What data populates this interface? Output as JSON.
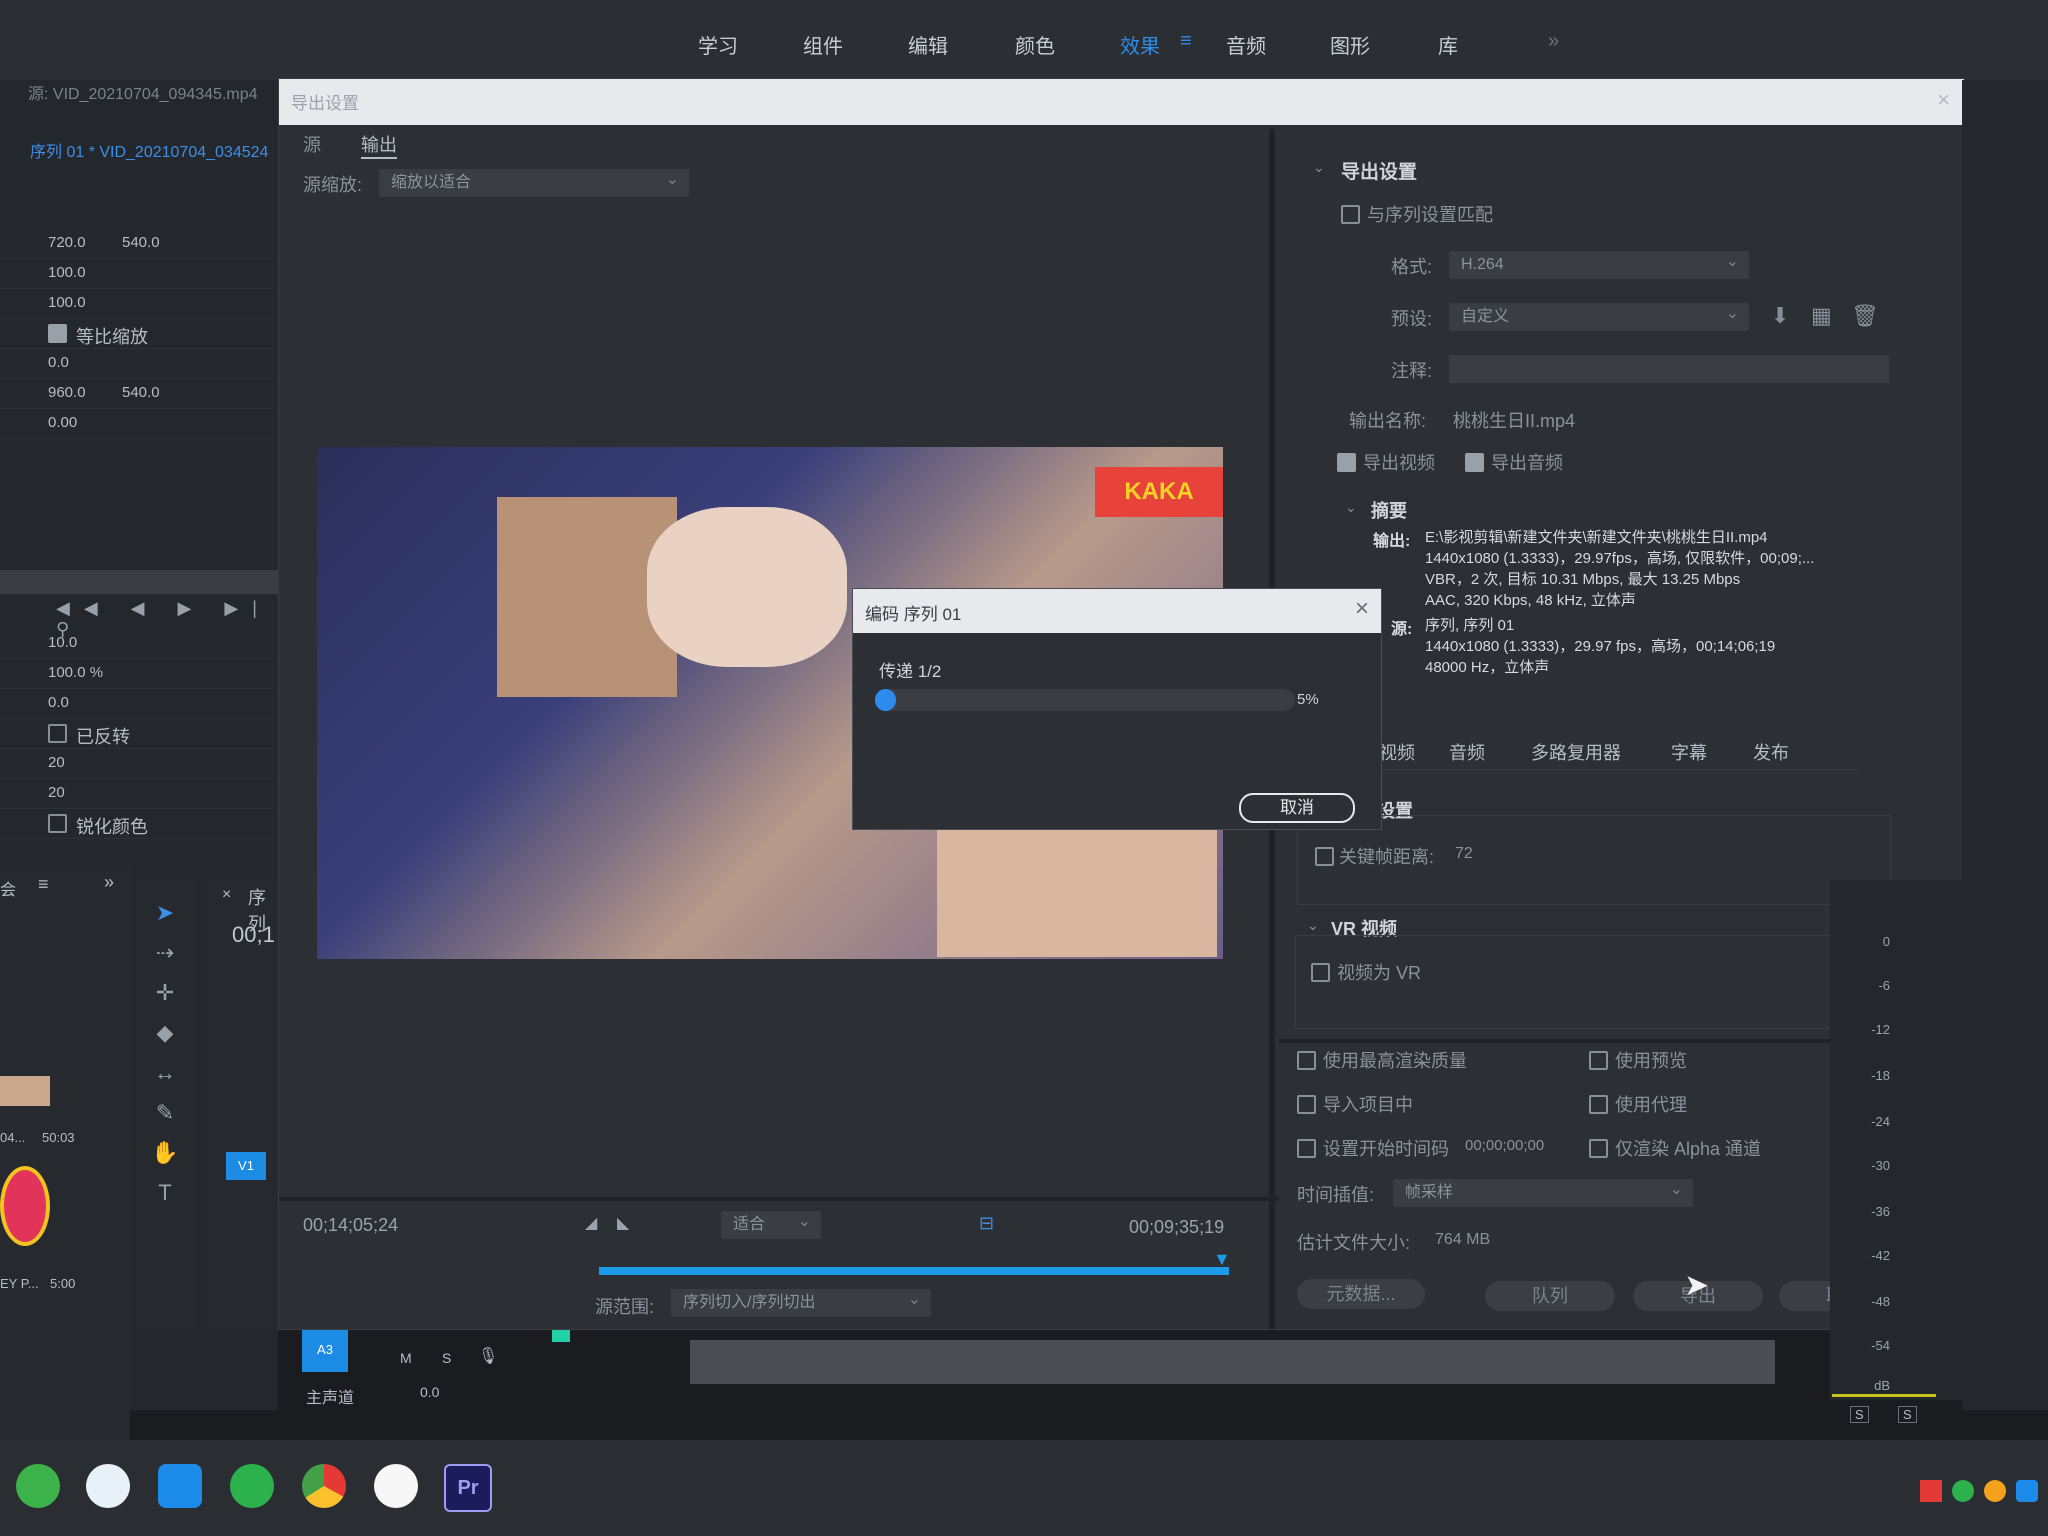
{
  "workspace_tabs": [
    "学习",
    "组件",
    "编辑",
    "颜色",
    "效果",
    "音频",
    "图形",
    "库"
  ],
  "active_workspace": "效果",
  "more_workspaces": "»",
  "source_tab": "源: VID_20210704_094345.mp4",
  "effect_controls": {
    "sequence_label": "序列 01 * VID_20210704_034524",
    "position": [
      "720.0",
      "540.0"
    ],
    "scale": "100.0",
    "scale_width": "100.0",
    "uniform_scale": "等比缩放",
    "rotation": "0.0",
    "anchor": [
      "960.0",
      "540.0"
    ],
    "anti_flicker": "0.00",
    "v2_values": [
      "10.0",
      "100.0 %",
      "0.0"
    ],
    "inverted": "已反转",
    "v3_values": [
      "20",
      "20"
    ],
    "sharpen": "锐化颜色"
  },
  "project_panel": {
    "tab_label": "会",
    "clip1_name": "04...",
    "clip1_dur": "50:03",
    "clip2_name": "EY P...",
    "clip2_dur": "5:00"
  },
  "timeline": {
    "tab_label": "序列",
    "timecode": "00;1",
    "track_v1": "V1",
    "track_a3": "A3",
    "m": "M",
    "s": "S",
    "master": "主声道",
    "master_val": "0.0"
  },
  "export_dialog": {
    "title": "导出设置",
    "tab_source": "源",
    "tab_output": "输出",
    "source_scaling_label": "源缩放:",
    "source_scaling_value": "缩放以适合",
    "watermark": "KAKA",
    "timecode_in": "00;14;05;24",
    "timecode_out": "00;09;35;19",
    "fit_label": "适合",
    "source_range_label": "源范围:",
    "source_range_value": "序列切入/序列切出",
    "settings_header": "导出设置",
    "match_sequence": "与序列设置匹配",
    "format_label": "格式:",
    "format_value": "H.264",
    "preset_label": "预设:",
    "preset_value": "自定义",
    "comments_label": "注释:",
    "output_name_label": "输出名称:",
    "output_name_value": "桃桃生日II.mp4",
    "export_video": "导出视频",
    "export_audio": "导出音频",
    "summary_header": "摘要",
    "summary_output_label": "输出:",
    "summary_output_lines": [
      "E:\\影视剪辑\\新建文件夹\\新建文件夹\\桃桃生日II.mp4",
      "1440x1080 (1.3333)，29.97fps，高场, 仅限软件，00;09;...",
      "VBR，2 次, 目标 10.31 Mbps, 最大 13.25 Mbps",
      "AAC, 320 Kbps, 48  kHz, 立体声"
    ],
    "summary_source_label": "源:",
    "summary_source_lines": [
      "序列, 序列 01",
      "1440x1080 (1.3333)，29.97 fps，高场，00;14;06;19",
      "48000 Hz，立体声"
    ],
    "tabs": [
      "视频",
      "音频",
      "多路复用器",
      "字幕",
      "发布"
    ],
    "settings_label": "设置",
    "keyframe_distance": "关键帧距离:",
    "keyframe_value": "72",
    "vr_header": "VR 视频",
    "video_is_vr": "视频为 VR",
    "max_render_quality": "使用最高渲染质量",
    "use_previews": "使用预览",
    "import_into_project": "导入项目中",
    "use_proxies": "使用代理",
    "set_start_timecode": "设置开始时间码",
    "start_timecode_value": "00;00;00;00",
    "render_alpha": "仅渲染 Alpha 通道",
    "time_interpolation_label": "时间插值:",
    "time_interpolation_value": "帧采样",
    "estimated_size_label": "估计文件大小:",
    "estimated_size_value": "764 MB",
    "btn_metadata": "元数据...",
    "btn_queue": "队列",
    "btn_export": "导出",
    "btn_cancel": "取消"
  },
  "encode_dialog": {
    "title": "编码 序列 01",
    "pass_label": "传递 1/2",
    "progress": 5,
    "progress_text": "5%",
    "cancel": "取消"
  },
  "audio_meter": {
    "ticks": [
      "0",
      "-6",
      "-12",
      "-18",
      "-24",
      "-30",
      "-36",
      "-42",
      "-48",
      "-54",
      "dB"
    ],
    "s_left": "S",
    "s_right": "S"
  },
  "taskbar": {
    "premiere": "Pr"
  }
}
